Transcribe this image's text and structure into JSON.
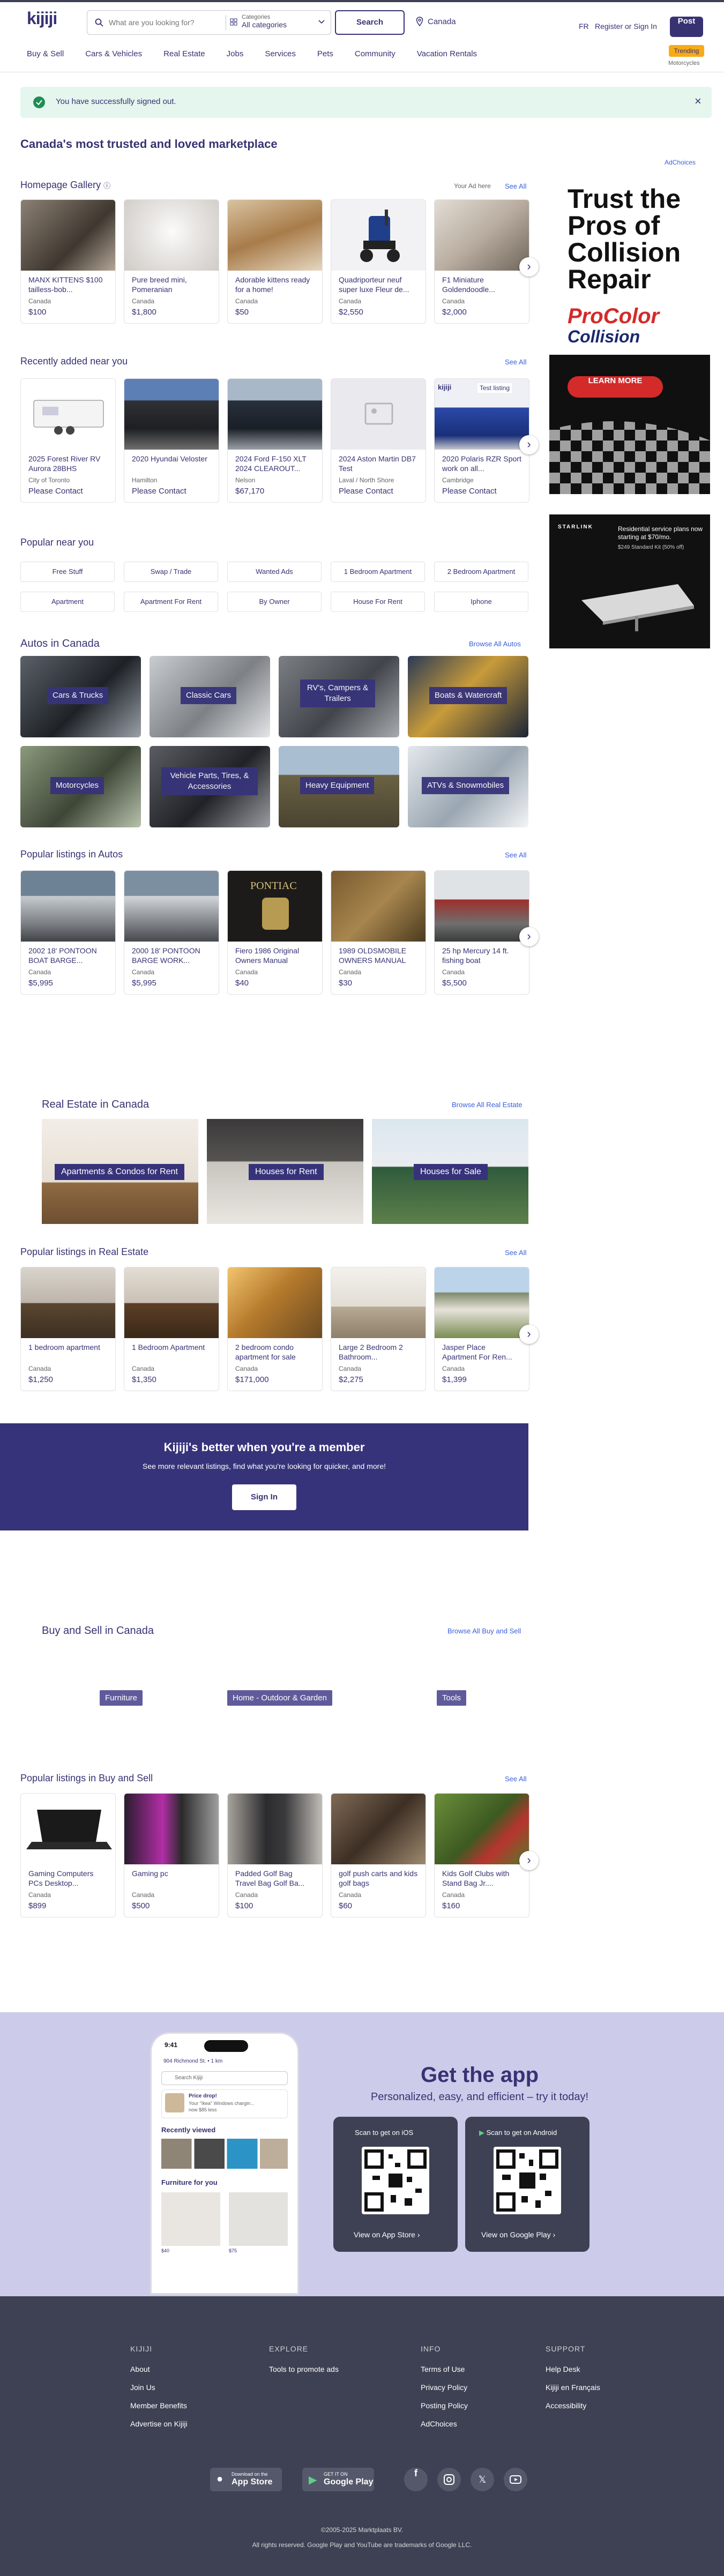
{
  "header": {
    "logo": "kijiji",
    "search_placeholder": "What are you looking for?",
    "categories_label": "Categories",
    "categories_value": "All categories",
    "search_button": "Search",
    "location": "Canada",
    "lang": "FR",
    "register": "Register or Sign In",
    "post": "Post"
  },
  "nav": [
    "Buy & Sell",
    "Cars & Vehicles",
    "Real Estate",
    "Jobs",
    "Services",
    "Pets",
    "Community",
    "Vacation Rentals"
  ],
  "trending": {
    "badge": "Trending",
    "sub": "Motorcycles"
  },
  "alert": "You have successfully signed out.",
  "hero_title": "Canada's most trusted and loved marketplace",
  "adchoices": "AdChoices",
  "gallery": {
    "title": "Homepage Gallery",
    "your_ad": "Your Ad here",
    "see_all": "See All",
    "items": [
      {
        "title": "MANX KITTENS $100 tailless-bob...",
        "loc": "Canada",
        "price": "$100"
      },
      {
        "title": "Pure breed mini, Pomeranian",
        "loc": "Canada",
        "price": "$1,800"
      },
      {
        "title": "Adorable kittens ready for a home!",
        "loc": "Canada",
        "price": "$50"
      },
      {
        "title": "Quadriporteur neuf super luxe Fleur de...",
        "loc": "Canada",
        "price": "$2,550"
      },
      {
        "title": "F1 Miniature Goldendoodle...",
        "loc": "Canada",
        "price": "$2,000"
      }
    ]
  },
  "recent": {
    "title": "Recently added near you",
    "see_all": "See All",
    "items": [
      {
        "title": "2025 Forest River RV Aurora 28BHS",
        "loc": "City of Toronto",
        "price": "Please Contact"
      },
      {
        "title": "2020 Hyundai Veloster",
        "loc": "Hamilton",
        "price": "Please Contact"
      },
      {
        "title": "2024 Ford F-150 XLT 2024 CLEAROUT...",
        "loc": "Nelson",
        "price": "$67,170"
      },
      {
        "title": "2024 Aston Martin DB7 Test",
        "loc": "Laval / North Shore",
        "price": "Please Contact"
      },
      {
        "title": "2020 Polaris RZR Sport work on all...",
        "loc": "Cambridge",
        "price": "Please Contact",
        "tag": "Test listing"
      }
    ]
  },
  "popular": {
    "title": "Popular near you",
    "chips": [
      "Free Stuff",
      "Swap / Trade",
      "Wanted Ads",
      "1 Bedroom Apartment",
      "2 Bedroom Apartment",
      "Apartment",
      "Apartment For Rent",
      "By Owner",
      "House For Rent",
      "Iphone"
    ]
  },
  "autos": {
    "title": "Autos in Canada",
    "browse": "Browse All Autos",
    "tiles": [
      "Cars & Trucks",
      "Classic Cars",
      "RV's, Campers & Trailers",
      "Boats & Watercraft",
      "Motorcycles",
      "Vehicle Parts, Tires, & Accessories",
      "Heavy Equipment",
      "ATVs & Snowmobiles"
    ]
  },
  "autos_popular": {
    "title": "Popular listings in Autos",
    "see_all": "See All",
    "items": [
      {
        "title": "2002 18' PONTOON BOAT BARGE...",
        "loc": "Canada",
        "price": "$5,995"
      },
      {
        "title": "2000 18' PONTOON BARGE WORK...",
        "loc": "Canada",
        "price": "$5,995"
      },
      {
        "title": "Fiero 1986 Original Owners Manual",
        "loc": "Canada",
        "price": "$40"
      },
      {
        "title": "1989 OLDSMOBILE OWNERS MANUAL",
        "loc": "Canada",
        "price": "$30"
      },
      {
        "title": "25 hp Mercury 14 ft. fishing boat",
        "loc": "Canada",
        "price": "$5,500"
      }
    ]
  },
  "realestate": {
    "title": "Real Estate in Canada",
    "browse": "Browse All Real Estate",
    "tiles": [
      "Apartments & Condos for Rent",
      "Houses for Rent",
      "Houses for Sale"
    ]
  },
  "re_popular": {
    "title": "Popular listings in Real Estate",
    "see_all": "See All",
    "items": [
      {
        "title": "1 bedroom apartment",
        "loc": "Canada",
        "price": "$1,250"
      },
      {
        "title": "1 Bedroom Apartment",
        "loc": "Canada",
        "price": "$1,350"
      },
      {
        "title": "2 bedroom condo apartment for sale",
        "loc": "Canada",
        "price": "$171,000"
      },
      {
        "title": "Large 2 Bedroom 2 Bathroom...",
        "loc": "Canada",
        "price": "$2,275"
      },
      {
        "title": "Jasper Place Apartment For Ren...",
        "loc": "Canada",
        "price": "$1,399"
      }
    ]
  },
  "member": {
    "title": "Kijiji's better when you're a member",
    "sub": "See more relevant listings, find what you're looking for quicker, and more!",
    "button": "Sign In"
  },
  "buysell": {
    "title": "Buy and Sell in Canada",
    "browse": "Browse All Buy and Sell",
    "tiles": [
      "Furniture",
      "Home - Outdoor & Garden",
      "Tools"
    ]
  },
  "bs_popular": {
    "title": "Popular listings in Buy and Sell",
    "see_all": "See All",
    "items": [
      {
        "title": "Gaming Computers PCs Desktop...",
        "loc": "Canada",
        "price": "$899"
      },
      {
        "title": "Gaming pc",
        "loc": "Canada",
        "price": "$500"
      },
      {
        "title": "Padded Golf Bag Travel Bag Golf Ba...",
        "loc": "Canada",
        "price": "$100"
      },
      {
        "title": "golf push carts and kids golf bags",
        "loc": "Canada",
        "price": "$60"
      },
      {
        "title": "Kids Golf Clubs with Stand Bag Jr....",
        "loc": "Canada",
        "price": "$160"
      }
    ]
  },
  "ads": {
    "ad1_lines": [
      "Trust the",
      "Pros of",
      "Collision",
      "Repair"
    ],
    "ad1_brand1": "ProColor",
    "ad1_brand2": "Collision",
    "ad1_cta": "LEARN MORE",
    "ad2_brand": "STARLINK",
    "ad2_text": "Residential service plans now starting at $70/mo.",
    "ad2_sub": "$249 Standard Kit (50% off)"
  },
  "app": {
    "title": "Get the app",
    "sub": "Personalized, easy, and efficient – try it today!",
    "ios_scan": "Scan to get on iOS",
    "android_scan": "Scan to get on Android",
    "ios_view": "View on App Store",
    "android_view": "View on Google Play",
    "phone_time": "9:41",
    "phone_addr": "904 Richmond St. • 1 km",
    "phone_search": "Search Kijiji",
    "phone_drop_title": "Price drop!",
    "phone_drop_text": "Your \"Ikea\" Windows chargin...",
    "phone_drop_price": "now $85 less",
    "phone_recent": "Recently viewed",
    "phone_furniture": "Furniture for you",
    "phone_p1": "$40",
    "phone_p2": "$75"
  },
  "footer": {
    "cols": [
      {
        "head": "KIJIJI",
        "links": [
          "About",
          "Join Us",
          "Member Benefits",
          "Advertise on Kijiji"
        ]
      },
      {
        "head": "EXPLORE",
        "links": [
          "Tools to promote ads"
        ]
      },
      {
        "head": "INFO",
        "links": [
          "Terms of Use",
          "Privacy Policy",
          "Posting Policy",
          "AdChoices"
        ]
      },
      {
        "head": "SUPPORT",
        "links": [
          "Help Desk",
          "Kijiji en Français",
          "Accessibility"
        ]
      }
    ],
    "appstore_small": "Download on the",
    "appstore_big": "App Store",
    "gplay_small": "GET IT ON",
    "gplay_big": "Google Play",
    "copyright": "©2005-2025 Marktplaats BV.",
    "rights": "All rights reserved. Google Play and YouTube are trademarks of Google LLC."
  }
}
